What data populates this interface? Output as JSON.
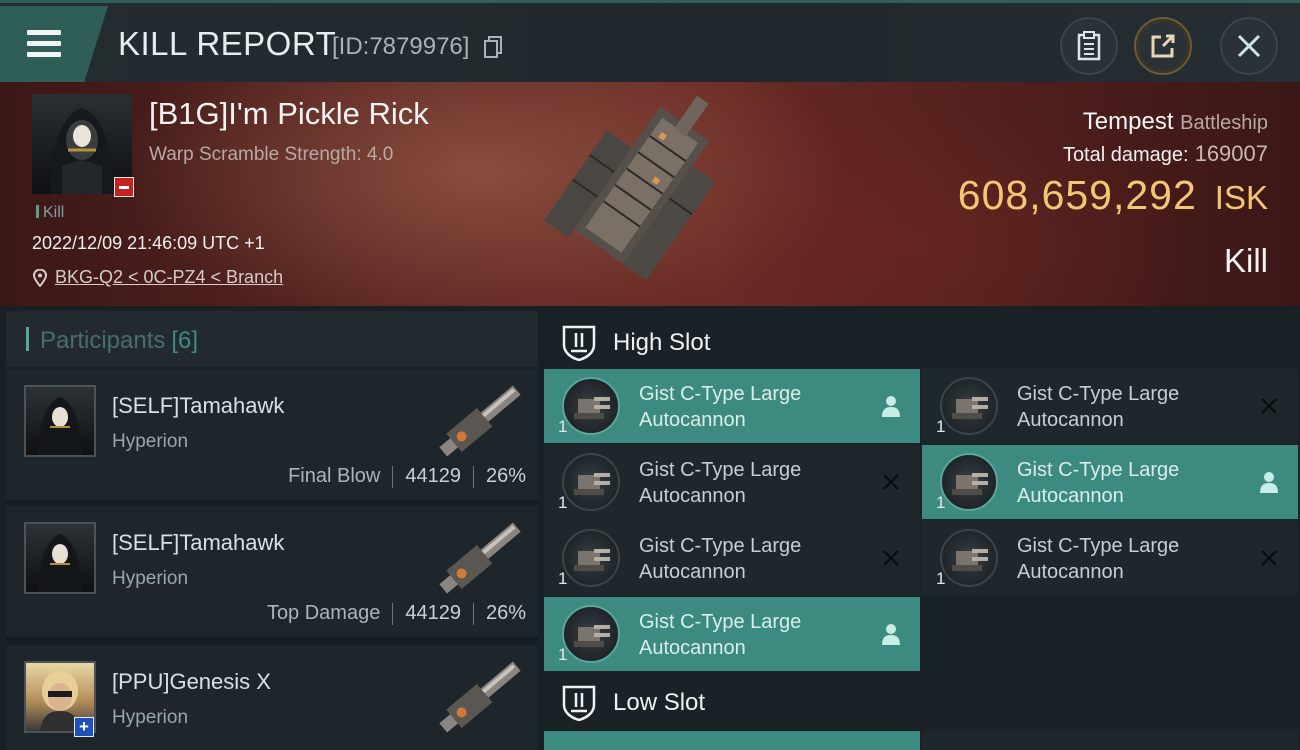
{
  "header": {
    "title": "KILL REPORT",
    "report_id": "[ID:7879976]"
  },
  "victim": {
    "name": "[B1G]I'm Pickle Rick",
    "warp_scramble": "Warp Scramble Strength: 4.0",
    "kill_tag": "Kill",
    "datetime": "2022/12/09 21:46:09 UTC +1",
    "location": "BKG-Q2 < 0C-PZ4 < Branch",
    "ship": "Tempest",
    "ship_class": "Battleship",
    "total_damage_label": "Total damage:",
    "total_damage": "169007",
    "isk_value": "608,659,292",
    "isk_unit": "ISK",
    "result": "Kill"
  },
  "participants": {
    "label": "Participants",
    "count": "[6]",
    "items": [
      {
        "name": "[SELF]Tamahawk",
        "ship": "Hyperion",
        "tag": "Final Blow",
        "damage": "44129",
        "percent": "26%"
      },
      {
        "name": "[SELF]Tamahawk",
        "ship": "Hyperion",
        "tag": "Top Damage",
        "damage": "44129",
        "percent": "26%"
      },
      {
        "name": "[PPU]Genesis X",
        "ship": "Hyperion"
      }
    ]
  },
  "slots": {
    "high_label": "High Slot",
    "low_label": "Low Slot",
    "high_modules": [
      {
        "line1": "Gist C-Type Large",
        "line2": "Autocannon",
        "qty": "1",
        "status": "pilot-icon",
        "active": true
      },
      {
        "line1": "Gist C-Type Large",
        "line2": "Autocannon",
        "qty": "1",
        "status": "destroyed-icon",
        "active": false
      },
      {
        "line1": "Gist C-Type Large",
        "line2": "Autocannon",
        "qty": "1",
        "status": "destroyed-icon",
        "active": false
      },
      {
        "line1": "Gist C-Type Large",
        "line2": "Autocannon",
        "qty": "1",
        "status": "pilot-icon",
        "active": true
      },
      {
        "line1": "Gist C-Type Large",
        "line2": "Autocannon",
        "qty": "1",
        "status": "destroyed-icon",
        "active": false
      },
      {
        "line1": "Gist C-Type Large",
        "line2": "Autocannon",
        "qty": "1",
        "status": "destroyed-icon",
        "active": false
      },
      {
        "line1": "Gist C-Type Large",
        "line2": "Autocannon",
        "qty": "1",
        "status": "pilot-icon",
        "active": true
      }
    ]
  },
  "colors": {
    "accent_teal": "#3d8a80",
    "isk_gold": "#f2c774",
    "banner_red": "#5a2420"
  }
}
